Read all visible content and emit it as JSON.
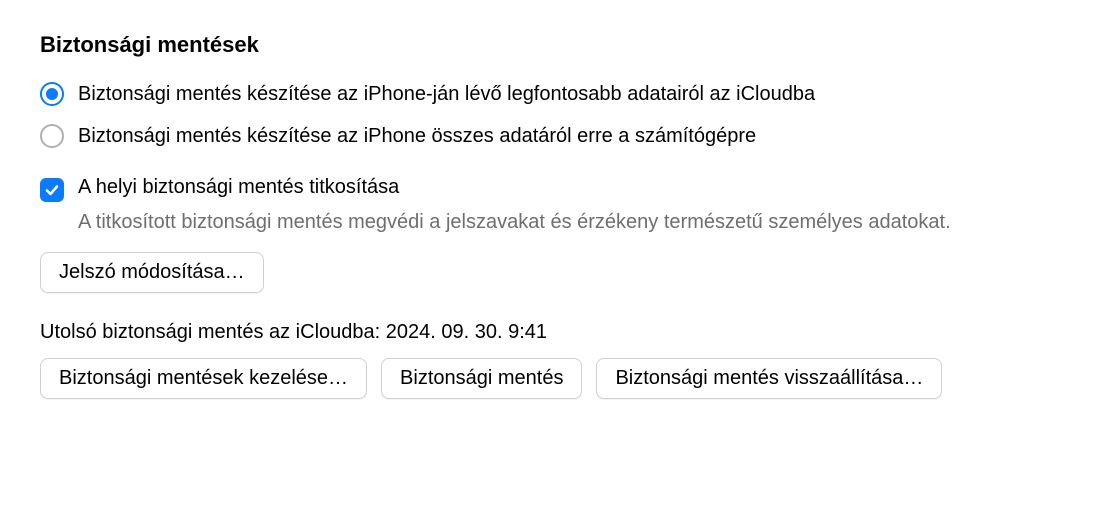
{
  "section_title": "Biztonsági mentések",
  "radio": {
    "icloud": "Biztonsági mentés készítése az iPhone-ján lévő legfontosabb adatairól az iCloudba",
    "local": "Biztonsági mentés készítése az iPhone összes adatáról erre a számítógépre"
  },
  "encrypt": {
    "label": "A helyi biztonsági mentés titkosítása",
    "description": "A titkosított biztonsági mentés megvédi a jelszavakat és érzékeny természetű személyes adatokat."
  },
  "buttons": {
    "change_password": "Jelszó módosítása…",
    "manage_backups": "Biztonsági mentések kezelése…",
    "backup_now": "Biztonsági mentés",
    "restore_backup": "Biztonsági mentés visszaállítása…"
  },
  "last_backup": "Utolsó biztonsági mentés az iCloudba: 2024. 09. 30. 9:41"
}
